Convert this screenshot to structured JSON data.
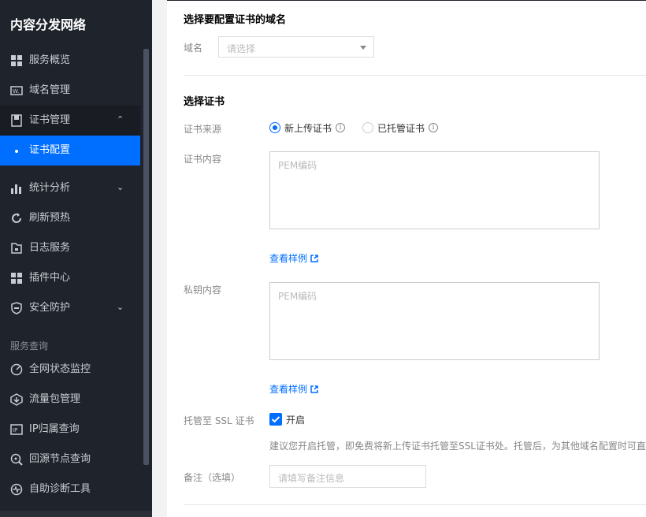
{
  "sidebar": {
    "brand": "内容分发网络",
    "items": [
      {
        "label": "服务概览",
        "icon": "grid-icon"
      },
      {
        "label": "域名管理",
        "icon": "domain-icon"
      },
      {
        "label": "证书管理",
        "icon": "certificate-icon",
        "chevron": "chevron-up"
      },
      {
        "label": "证书配置",
        "icon": "dot-icon"
      },
      {
        "label": "统计分析",
        "icon": "bar-chart-icon",
        "chevron": "chevron-down"
      },
      {
        "label": "刷新预热",
        "icon": "refresh-icon"
      },
      {
        "label": "日志服务",
        "icon": "log-icon"
      },
      {
        "label": "插件中心",
        "icon": "plugin-icon"
      },
      {
        "label": "安全防护",
        "icon": "shield-icon",
        "chevron": "chevron-down"
      }
    ],
    "group_title": "服务查询",
    "group_items": [
      {
        "label": "全网状态监控",
        "icon": "monitor-icon"
      },
      {
        "label": "流量包管理",
        "icon": "traffic-pack-icon"
      },
      {
        "label": "IP归属查询",
        "icon": "ip-icon"
      },
      {
        "label": "回源节点查询",
        "icon": "search-node-icon"
      },
      {
        "label": "自助诊断工具",
        "icon": "diagnose-icon"
      }
    ],
    "accent_color": "#006eff"
  },
  "main": {
    "section1_title": "选择要配置证书的域名",
    "domain_label": "域名",
    "domain_placeholder": "请选择",
    "section2_title": "选择证书",
    "cert_source_label": "证书来源",
    "radio_new": "新上传证书",
    "radio_hosted": "已托管证书",
    "cert_content_label": "证书内容",
    "cert_placeholder": "PEM编码",
    "view_sample_1": "查看样例",
    "private_key_label": "私钥内容",
    "key_placeholder": "PEM编码",
    "view_sample_2": "查看样例",
    "ssl_host_label": "托管至 SSL 证书",
    "ssl_host_checkbox": "开启",
    "ssl_host_hint": "建议您开启托管，即免费将新上传证书托管至SSL证书处。托管后，为其他域名配置时可直",
    "remark_label": "备注（选填）",
    "remark_placeholder": "请填写备注信息"
  }
}
